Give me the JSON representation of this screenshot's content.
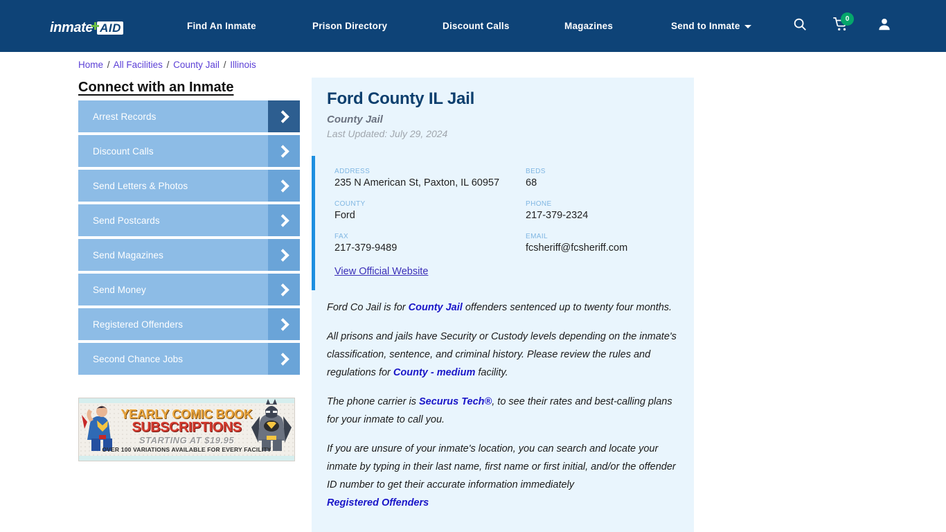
{
  "brand": {
    "logo_word": "inmate",
    "logo_badge": "AID",
    "accent_green": "#6cbf45",
    "header_bg": "#0e4377"
  },
  "nav": {
    "items": [
      {
        "label": "Find An Inmate"
      },
      {
        "label": "Prison Directory"
      },
      {
        "label": "Discount Calls"
      },
      {
        "label": "Magazines"
      },
      {
        "label": "Send to Inmate"
      }
    ],
    "cart_count": "0",
    "icons": [
      "search-icon",
      "cart-icon",
      "user-icon"
    ]
  },
  "breadcrumb": {
    "items": [
      "Home",
      "All Facilities",
      "County Jail",
      "Illinois"
    ],
    "separator": "/"
  },
  "sidebar": {
    "title": "Connect with an Inmate",
    "items": [
      {
        "label": "Arrest Records",
        "active": true
      },
      {
        "label": "Discount Calls",
        "active": false
      },
      {
        "label": "Send Letters & Photos",
        "active": false
      },
      {
        "label": "Send Postcards",
        "active": false
      },
      {
        "label": "Send Magazines",
        "active": false
      },
      {
        "label": "Send Money",
        "active": false
      },
      {
        "label": "Registered Offenders",
        "active": false
      },
      {
        "label": "Second Chance Jobs",
        "active": false
      }
    ]
  },
  "ad": {
    "line1": "YEARLY COMIC BOOK",
    "line2": "SUBSCRIPTIONS",
    "line3": "STARTING AT $19.95",
    "line4": "OVER 100 VARIATIONS AVAILABLE FOR EVERY FACILITY"
  },
  "facility": {
    "title": "Ford County IL Jail",
    "subtitle": "County Jail",
    "last_updated": "Last Updated: July 29, 2024",
    "fields": [
      {
        "label": "ADDRESS",
        "value": "235 N American St, Paxton, IL 60957"
      },
      {
        "label": "BEDS",
        "value": "68"
      },
      {
        "label": "COUNTY",
        "value": "Ford"
      },
      {
        "label": "PHONE",
        "value": "217-379-2324"
      },
      {
        "label": "FAX",
        "value": "217-379-9489"
      },
      {
        "label": "EMAIL",
        "value": "fcsheriff@fcsheriff.com"
      }
    ],
    "official_website_label": "View Official Website",
    "accent_color": "#1e8fe0"
  },
  "description": {
    "p1_a": "Ford Co Jail is for ",
    "p1_link": "County Jail",
    "p1_b": " offenders sentenced up to twenty four months.",
    "p2_a": "All prisons and jails have Security or Custody levels depending on the inmate's classification, sentence, and criminal history. Please review the rules and regulations for ",
    "p2_link": "County - medium",
    "p2_b": " facility.",
    "p3_a": "The phone carrier is ",
    "p3_link": "Securus Tech®",
    "p3_b": ", to see their rates and best-calling plans for your inmate to call you.",
    "p4": "If you are unsure of your inmate's location, you can search and locate your inmate by typing in their last name, first name or first initial, and/or the offender ID number to get their accurate information immediately",
    "p4_link": "Registered Offenders"
  }
}
